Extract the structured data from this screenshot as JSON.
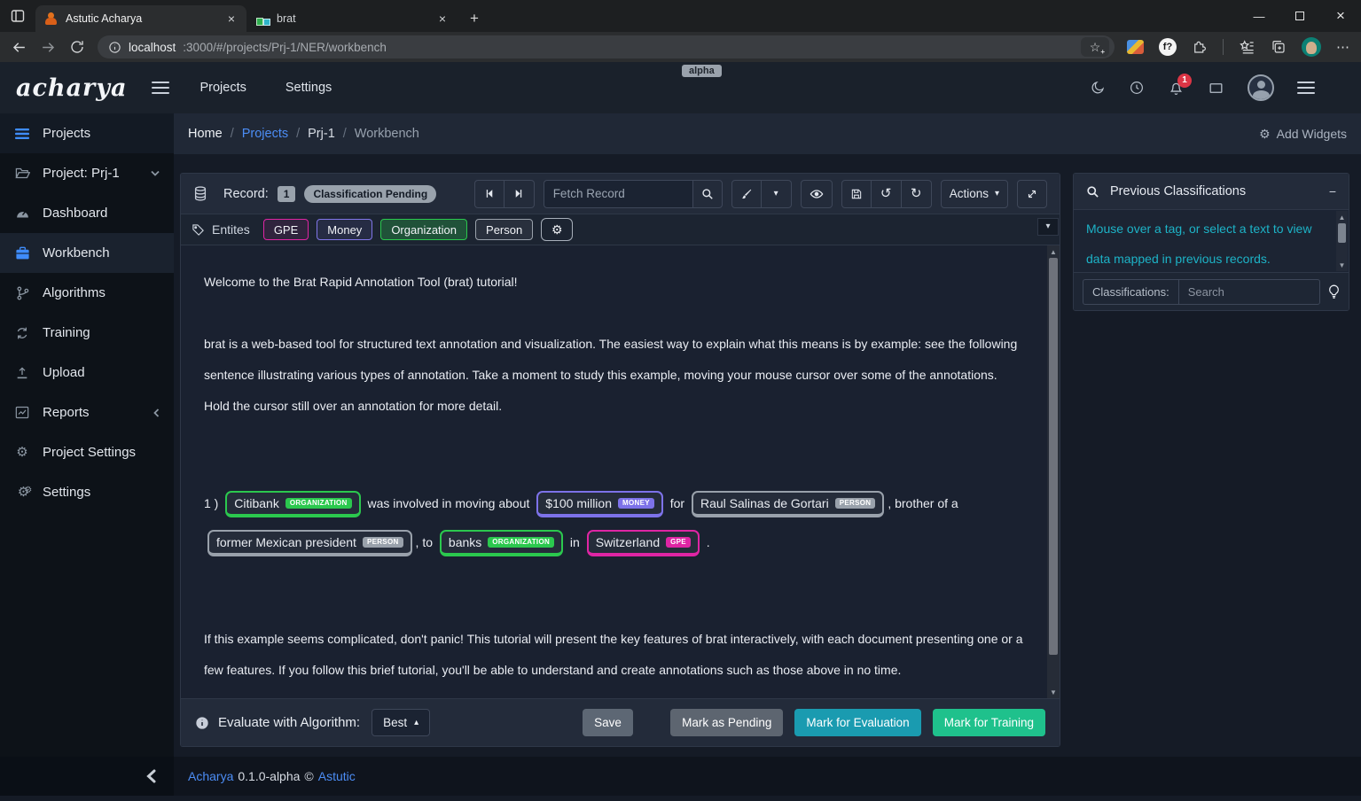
{
  "browser": {
    "tabs": [
      {
        "title": "Astutic Acharya"
      },
      {
        "title": "brat"
      }
    ],
    "url": {
      "host": "localhost",
      "rest": ":3000/#/projects/Prj-1/NER/workbench"
    }
  },
  "icons": {
    "gear": "⚙",
    "undo": "↺",
    "redo": "↻",
    "caret_down": "▾",
    "caret_up": "▴",
    "arrow_up": "▲",
    "arrow_down": "▼",
    "close": "×",
    "plus": "+",
    "ellipsis": "⋯",
    "minus": "−",
    "minimize": "—",
    "star": "☆",
    "star_plus": "+",
    "chevron_left_big": "❬"
  },
  "navbar": {
    "logo": "acharya",
    "links": [
      {
        "label": "Projects"
      },
      {
        "label": "Settings"
      }
    ],
    "alpha_badge": "alpha",
    "notification_count": "1"
  },
  "breadcrumb": {
    "items": [
      "Home",
      "Projects",
      "Prj-1",
      "Workbench"
    ],
    "separator": "/",
    "add_widgets_label": "Add Widgets"
  },
  "sidebar": {
    "items": [
      {
        "label": "Projects"
      },
      {
        "label": "Project: Prj-1"
      },
      {
        "label": "Dashboard"
      },
      {
        "label": "Workbench"
      },
      {
        "label": "Algorithms"
      },
      {
        "label": "Training"
      },
      {
        "label": "Upload"
      },
      {
        "label": "Reports"
      },
      {
        "label": "Project Settings"
      },
      {
        "label": "Settings"
      }
    ]
  },
  "workbench": {
    "record_label": "Record:",
    "record_number": "1",
    "status_badge": "Classification Pending",
    "fetch_placeholder": "Fetch Record",
    "actions_label": "Actions",
    "entities": {
      "label": "Entites",
      "tags": [
        {
          "name": "GPE",
          "color": "#df25a4",
          "bg_alpha": 0.1
        },
        {
          "name": "Money",
          "color": "#8076e8",
          "bg_alpha": 0.1
        },
        {
          "name": "Organization",
          "color": "#2bc84e",
          "bg_alpha": 0.28
        },
        {
          "name": "Person",
          "color": "#99a1ab",
          "bg_alpha": 0.1
        }
      ]
    },
    "entity_colors": {
      "ORGANIZATION": "#2bc84e",
      "MONEY": "#7d72e9",
      "PERSON": "#99a1ab",
      "GPE": "#df25a4"
    },
    "document": {
      "p1": "Welcome to the Brat Rapid Annotation Tool (brat) tutorial!",
      "p2": "brat is a web-based tool for structured text annotation and visualization. The easiest way to explain what this means is by example: see the following sentence illustrating various types of annotation. Take a moment to study this example, moving your mouse cursor over some of the annotations. Hold the cursor still over an annotation for more detail.",
      "p3": "If this example seems complicated, don't panic! This tutorial will present the key features of brat interactively, with each document presenting one or a few features. If you follow this brief tutorial, you'll be able to understand and create annotations such as those above in no time."
    },
    "sentence": [
      {
        "text": "1 ) "
      },
      {
        "text": "Citibank",
        "label": "ORGANIZATION"
      },
      {
        "text": " was involved in moving about "
      },
      {
        "text": "$100 million",
        "label": "MONEY"
      },
      {
        "text": " for "
      },
      {
        "text": "Raul Salinas de Gortari",
        "label": "PERSON"
      },
      {
        "text": ", brother of a "
      },
      {
        "text": "former Mexican president",
        "label": "PERSON"
      },
      {
        "text": ", to "
      },
      {
        "text": "banks",
        "label": "ORGANIZATION"
      },
      {
        "text": " in "
      },
      {
        "text": "Switzerland",
        "label": "GPE"
      },
      {
        "text": " ."
      }
    ]
  },
  "bottom_bar": {
    "evaluate_label": "Evaluate with Algorithm:",
    "algorithm_selected": "Best",
    "save_label": "Save",
    "mark_pending_label": "Mark as Pending",
    "mark_evaluation_label": "Mark for Evaluation",
    "mark_training_label": "Mark for Training",
    "colors": {
      "save": "#5d6774",
      "pending": "#5d6570",
      "evaluation": "#1a9bb0",
      "training": "#1fc18c"
    }
  },
  "right_panel": {
    "title": "Previous Classifications",
    "hint": "Mouse over a tag, or select a text to view data mapped in previous records.",
    "hint_color": "#1db3c7",
    "classifications_label": "Classifications:",
    "search_placeholder": "Search"
  },
  "footer": {
    "app_link": "Acharya",
    "version": "0.1.0-alpha",
    "copyright": "©",
    "company_link": "Astutic"
  }
}
